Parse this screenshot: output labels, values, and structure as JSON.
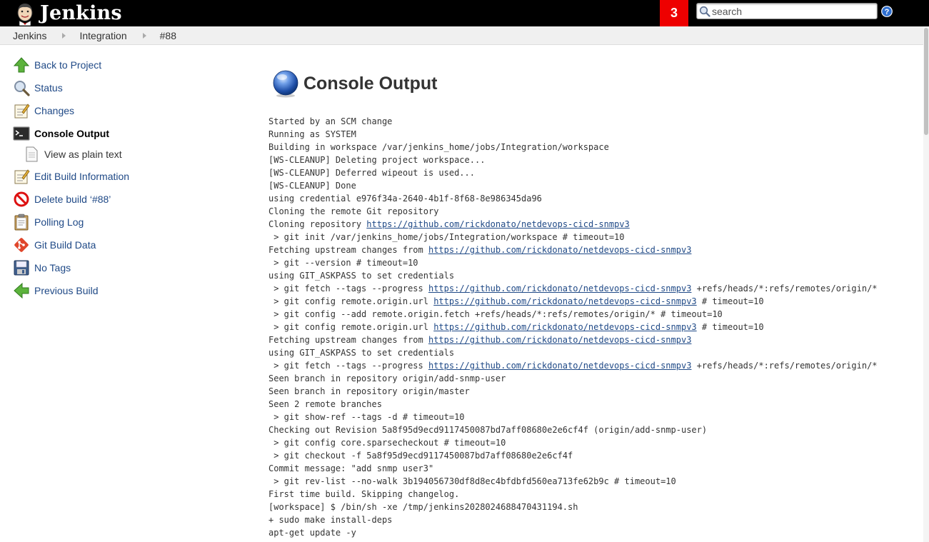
{
  "header": {
    "logo_text": "Jenkins",
    "notification_count": "3",
    "search_placeholder": "search",
    "help_label": "?"
  },
  "breadcrumb": [
    "Jenkins",
    "Integration",
    "#88"
  ],
  "side_panel": {
    "tasks": [
      {
        "label": "Back to Project",
        "icon": "up-arrow-icon"
      },
      {
        "label": "Status",
        "icon": "magnifier-icon"
      },
      {
        "label": "Changes",
        "icon": "notepad-icon"
      },
      {
        "label": "Console Output",
        "icon": "terminal-icon",
        "active": true
      },
      {
        "label": "View as plain text",
        "icon": "document-icon",
        "sub": true
      },
      {
        "label": "Edit Build Information",
        "icon": "notepad-icon"
      },
      {
        "label": "Delete build ‘#88’",
        "icon": "no-entry-icon"
      },
      {
        "label": "Polling Log",
        "icon": "clipboard-icon"
      },
      {
        "label": "Git Build Data",
        "icon": "git-icon"
      },
      {
        "label": "No Tags",
        "icon": "floppy-icon"
      },
      {
        "label": "Previous Build",
        "icon": "left-arrow-icon"
      }
    ]
  },
  "main": {
    "title": "Console Output",
    "console_lines": [
      [
        {
          "t": "Started by an SCM change"
        }
      ],
      [
        {
          "t": "Running as SYSTEM"
        }
      ],
      [
        {
          "t": "Building in workspace /var/jenkins_home/jobs/Integration/workspace"
        }
      ],
      [
        {
          "t": "[WS-CLEANUP] Deleting project workspace..."
        }
      ],
      [
        {
          "t": "[WS-CLEANUP] Deferred wipeout is used..."
        }
      ],
      [
        {
          "t": "[WS-CLEANUP] Done"
        }
      ],
      [
        {
          "t": "using credential e976f34a-2640-4b1f-8f68-8e986345da96"
        }
      ],
      [
        {
          "t": "Cloning the remote Git repository"
        }
      ],
      [
        {
          "t": "Cloning repository "
        },
        {
          "t": "https://github.com/rickdonato/netdevops-cicd-snmpv3",
          "link": true
        }
      ],
      [
        {
          "t": " > git init /var/jenkins_home/jobs/Integration/workspace # timeout=10"
        }
      ],
      [
        {
          "t": "Fetching upstream changes from "
        },
        {
          "t": "https://github.com/rickdonato/netdevops-cicd-snmpv3",
          "link": true
        }
      ],
      [
        {
          "t": " > git --version # timeout=10"
        }
      ],
      [
        {
          "t": "using GIT_ASKPASS to set credentials"
        }
      ],
      [
        {
          "t": " > git fetch --tags --progress "
        },
        {
          "t": "https://github.com/rickdonato/netdevops-cicd-snmpv3",
          "link": true
        },
        {
          "t": " +refs/heads/*:refs/remotes/origin/*"
        }
      ],
      [
        {
          "t": " > git config remote.origin.url "
        },
        {
          "t": "https://github.com/rickdonato/netdevops-cicd-snmpv3",
          "link": true
        },
        {
          "t": " # timeout=10"
        }
      ],
      [
        {
          "t": " > git config --add remote.origin.fetch +refs/heads/*:refs/remotes/origin/* # timeout=10"
        }
      ],
      [
        {
          "t": " > git config remote.origin.url "
        },
        {
          "t": "https://github.com/rickdonato/netdevops-cicd-snmpv3",
          "link": true
        },
        {
          "t": " # timeout=10"
        }
      ],
      [
        {
          "t": "Fetching upstream changes from "
        },
        {
          "t": "https://github.com/rickdonato/netdevops-cicd-snmpv3",
          "link": true
        }
      ],
      [
        {
          "t": "using GIT_ASKPASS to set credentials"
        }
      ],
      [
        {
          "t": " > git fetch --tags --progress "
        },
        {
          "t": "https://github.com/rickdonato/netdevops-cicd-snmpv3",
          "link": true
        },
        {
          "t": " +refs/heads/*:refs/remotes/origin/*"
        }
      ],
      [
        {
          "t": "Seen branch in repository origin/add-snmp-user"
        }
      ],
      [
        {
          "t": "Seen branch in repository origin/master"
        }
      ],
      [
        {
          "t": "Seen 2 remote branches"
        }
      ],
      [
        {
          "t": " > git show-ref --tags -d # timeout=10"
        }
      ],
      [
        {
          "t": "Checking out Revision 5a8f95d9ecd9117450087bd7aff08680e2e6cf4f (origin/add-snmp-user)"
        }
      ],
      [
        {
          "t": " > git config core.sparsecheckout # timeout=10"
        }
      ],
      [
        {
          "t": " > git checkout -f 5a8f95d9ecd9117450087bd7aff08680e2e6cf4f"
        }
      ],
      [
        {
          "t": "Commit message: \"add snmp user3\""
        }
      ],
      [
        {
          "t": " > git rev-list --no-walk 3b194056730df8d8ec4bfdbfd560ea713fe62b9c # timeout=10"
        }
      ],
      [
        {
          "t": "First time build. Skipping changelog."
        }
      ],
      [
        {
          "t": "[workspace] $ /bin/sh -xe /tmp/jenkins2028024688470431194.sh"
        }
      ],
      [
        {
          "t": "+ sudo make install-deps"
        }
      ],
      [
        {
          "t": "apt-get update -y"
        }
      ]
    ]
  },
  "colors": {
    "header_bg": "#000000",
    "notification_bg": "#ee0000",
    "link": "#204a87",
    "breadcrumb_bg": "#f0f0f0"
  }
}
